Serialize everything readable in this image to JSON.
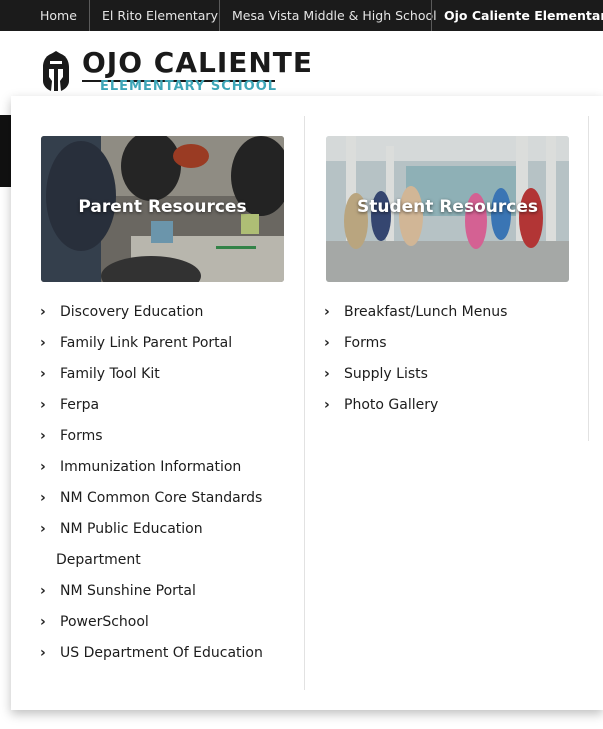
{
  "topnav": {
    "items": [
      {
        "label": "Home"
      },
      {
        "label": "El Rito Elementary"
      },
      {
        "label": "Mesa Vista Middle & High School"
      },
      {
        "label": "Ojo Caliente Elementary"
      }
    ],
    "active_index": 3
  },
  "school": {
    "name": "OJO CALIENTE",
    "subtitle": "ELEMENTARY SCHOOL"
  },
  "menu": {
    "parent": {
      "card_title": "Parent Resources",
      "links": [
        "Discovery Education",
        "Family Link Parent Portal",
        "Family Tool Kit",
        "Ferpa",
        "Forms",
        "Immunization Information",
        "NM Common Core Standards",
        "NM Public Education",
        "Department",
        "NM Sunshine Portal",
        "PowerSchool",
        "US Department Of Education"
      ]
    },
    "student": {
      "card_title": "Student Resources",
      "links": [
        "Breakfast/Lunch Menus",
        "Forms",
        "Supply Lists",
        "Photo Gallery"
      ]
    }
  },
  "colors": {
    "nav_bg": "#1b1b1b",
    "accent_teal": "#3fa6b8"
  },
  "icons": {
    "logo": "spartan-helmet-icon",
    "link_marker": "chevron-right-icon"
  }
}
